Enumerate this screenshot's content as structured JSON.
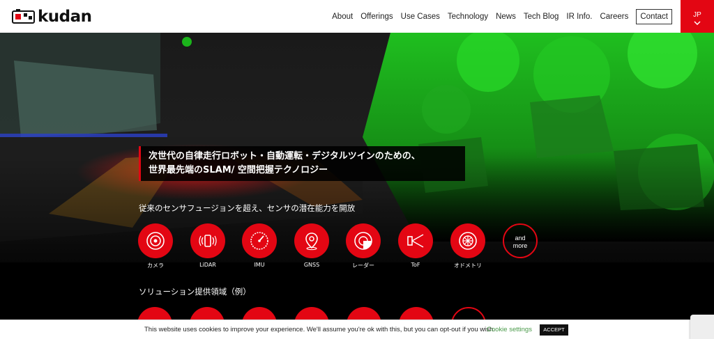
{
  "brand": {
    "name": "kudan"
  },
  "nav": {
    "items": [
      {
        "label": "About"
      },
      {
        "label": "Offerings"
      },
      {
        "label": "Use Cases"
      },
      {
        "label": "Technology"
      },
      {
        "label": "News"
      },
      {
        "label": "Tech Blog"
      },
      {
        "label": "IR Info."
      },
      {
        "label": "Careers"
      }
    ],
    "contact": "Contact",
    "language": "JP"
  },
  "hero": {
    "headline_line1": "次世代の自律走行ロボット・自動運転・デジタルツインのための、",
    "headline_line2": "世界最先端のSLAM/ 空間把握テクノロジー"
  },
  "sensors": {
    "title": "従来のセンサフュージョンを超え、センサの潜在能力を開放",
    "items": [
      {
        "label": "カメラ",
        "icon": "camera-icon"
      },
      {
        "label": "LiDAR",
        "icon": "lidar-icon"
      },
      {
        "label": "IMU",
        "icon": "gauge-icon"
      },
      {
        "label": "GNSS",
        "icon": "location-pin-icon"
      },
      {
        "label": "レーダー",
        "icon": "radar-icon"
      },
      {
        "label": "ToF",
        "icon": "tof-icon"
      },
      {
        "label": "オドメトリ",
        "icon": "odometry-icon"
      }
    ],
    "more_line1": "and",
    "more_line2": "more"
  },
  "solutions": {
    "title": "ソリューション提供領域（例）"
  },
  "cookie": {
    "text": "This website uses cookies to improve your experience. We'll assume you're ok with this, but you can opt-out if you wish.",
    "settings": "Cookie settings",
    "accept": "ACCEPT"
  },
  "colors": {
    "accent": "#e30613",
    "green": "#2fd62f",
    "dark": "#000000"
  }
}
